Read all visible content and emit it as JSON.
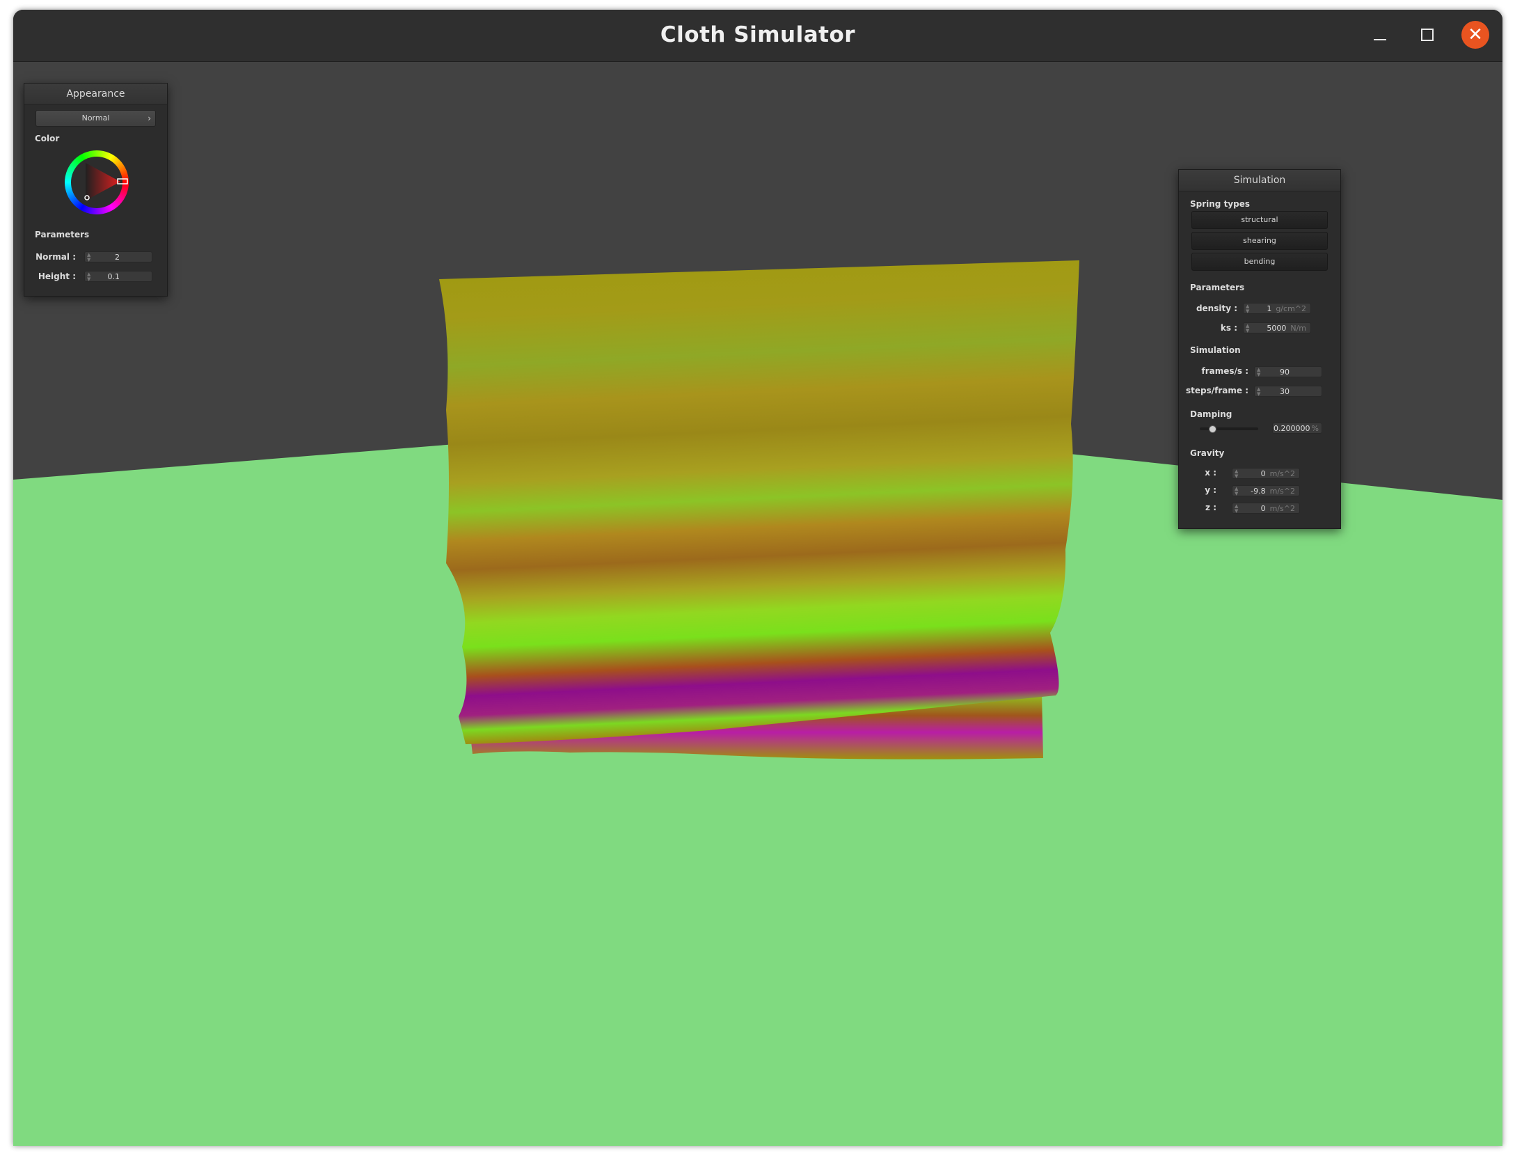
{
  "window": {
    "title": "Cloth Simulator",
    "buttons": {
      "minimize": "minimize-icon",
      "maximize": "maximize-icon",
      "close": "close-icon"
    },
    "accent_color": "#e95420"
  },
  "appearance": {
    "title": "Appearance",
    "shader_selected": "Normal",
    "color_label": "Color",
    "params_label": "Parameters",
    "normal_label": "Normal :",
    "normal_value": "2",
    "height_label": "Height :",
    "height_value": "0.1"
  },
  "simulation": {
    "title": "Simulation",
    "spring_types_label": "Spring types",
    "spring_buttons": [
      "structural",
      "shearing",
      "bending"
    ],
    "params_label": "Parameters",
    "density_label": "density :",
    "density_value": "1",
    "density_unit": "g/cm^2",
    "ks_label": "ks :",
    "ks_value": "5000",
    "ks_unit": "N/m",
    "sim_label": "Simulation",
    "fps_label": "frames/s :",
    "fps_value": "90",
    "steps_label": "steps/frame :",
    "steps_value": "30",
    "damping_label": "Damping",
    "damping_value": "0.200000",
    "damping_unit": "%",
    "damping_fraction": 0.2,
    "gravity_label": "Gravity",
    "gx_label": "x :",
    "gx_value": "0",
    "gy_label": "y :",
    "gy_value": "-9.8",
    "gz_label": "z :",
    "gz_value": "0",
    "gravity_unit": "m/s^2"
  },
  "scene": {
    "floor_color": "#80da80",
    "background_color": "#424242"
  }
}
